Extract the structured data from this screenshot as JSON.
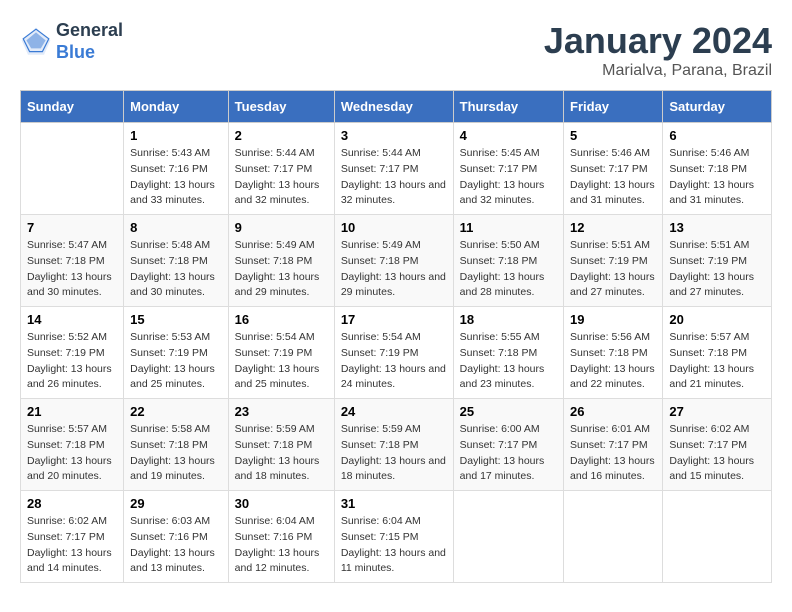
{
  "logo": {
    "line1": "General",
    "line2": "Blue"
  },
  "title": "January 2024",
  "subtitle": "Marialva, Parana, Brazil",
  "days_of_week": [
    "Sunday",
    "Monday",
    "Tuesday",
    "Wednesday",
    "Thursday",
    "Friday",
    "Saturday"
  ],
  "weeks": [
    [
      {
        "day": "",
        "sunrise": "",
        "sunset": "",
        "daylight": ""
      },
      {
        "day": "1",
        "sunrise": "Sunrise: 5:43 AM",
        "sunset": "Sunset: 7:16 PM",
        "daylight": "Daylight: 13 hours and 33 minutes."
      },
      {
        "day": "2",
        "sunrise": "Sunrise: 5:44 AM",
        "sunset": "Sunset: 7:17 PM",
        "daylight": "Daylight: 13 hours and 32 minutes."
      },
      {
        "day": "3",
        "sunrise": "Sunrise: 5:44 AM",
        "sunset": "Sunset: 7:17 PM",
        "daylight": "Daylight: 13 hours and 32 minutes."
      },
      {
        "day": "4",
        "sunrise": "Sunrise: 5:45 AM",
        "sunset": "Sunset: 7:17 PM",
        "daylight": "Daylight: 13 hours and 32 minutes."
      },
      {
        "day": "5",
        "sunrise": "Sunrise: 5:46 AM",
        "sunset": "Sunset: 7:17 PM",
        "daylight": "Daylight: 13 hours and 31 minutes."
      },
      {
        "day": "6",
        "sunrise": "Sunrise: 5:46 AM",
        "sunset": "Sunset: 7:18 PM",
        "daylight": "Daylight: 13 hours and 31 minutes."
      }
    ],
    [
      {
        "day": "7",
        "sunrise": "Sunrise: 5:47 AM",
        "sunset": "Sunset: 7:18 PM",
        "daylight": "Daylight: 13 hours and 30 minutes."
      },
      {
        "day": "8",
        "sunrise": "Sunrise: 5:48 AM",
        "sunset": "Sunset: 7:18 PM",
        "daylight": "Daylight: 13 hours and 30 minutes."
      },
      {
        "day": "9",
        "sunrise": "Sunrise: 5:49 AM",
        "sunset": "Sunset: 7:18 PM",
        "daylight": "Daylight: 13 hours and 29 minutes."
      },
      {
        "day": "10",
        "sunrise": "Sunrise: 5:49 AM",
        "sunset": "Sunset: 7:18 PM",
        "daylight": "Daylight: 13 hours and 29 minutes."
      },
      {
        "day": "11",
        "sunrise": "Sunrise: 5:50 AM",
        "sunset": "Sunset: 7:18 PM",
        "daylight": "Daylight: 13 hours and 28 minutes."
      },
      {
        "day": "12",
        "sunrise": "Sunrise: 5:51 AM",
        "sunset": "Sunset: 7:19 PM",
        "daylight": "Daylight: 13 hours and 27 minutes."
      },
      {
        "day": "13",
        "sunrise": "Sunrise: 5:51 AM",
        "sunset": "Sunset: 7:19 PM",
        "daylight": "Daylight: 13 hours and 27 minutes."
      }
    ],
    [
      {
        "day": "14",
        "sunrise": "Sunrise: 5:52 AM",
        "sunset": "Sunset: 7:19 PM",
        "daylight": "Daylight: 13 hours and 26 minutes."
      },
      {
        "day": "15",
        "sunrise": "Sunrise: 5:53 AM",
        "sunset": "Sunset: 7:19 PM",
        "daylight": "Daylight: 13 hours and 25 minutes."
      },
      {
        "day": "16",
        "sunrise": "Sunrise: 5:54 AM",
        "sunset": "Sunset: 7:19 PM",
        "daylight": "Daylight: 13 hours and 25 minutes."
      },
      {
        "day": "17",
        "sunrise": "Sunrise: 5:54 AM",
        "sunset": "Sunset: 7:19 PM",
        "daylight": "Daylight: 13 hours and 24 minutes."
      },
      {
        "day": "18",
        "sunrise": "Sunrise: 5:55 AM",
        "sunset": "Sunset: 7:18 PM",
        "daylight": "Daylight: 13 hours and 23 minutes."
      },
      {
        "day": "19",
        "sunrise": "Sunrise: 5:56 AM",
        "sunset": "Sunset: 7:18 PM",
        "daylight": "Daylight: 13 hours and 22 minutes."
      },
      {
        "day": "20",
        "sunrise": "Sunrise: 5:57 AM",
        "sunset": "Sunset: 7:18 PM",
        "daylight": "Daylight: 13 hours and 21 minutes."
      }
    ],
    [
      {
        "day": "21",
        "sunrise": "Sunrise: 5:57 AM",
        "sunset": "Sunset: 7:18 PM",
        "daylight": "Daylight: 13 hours and 20 minutes."
      },
      {
        "day": "22",
        "sunrise": "Sunrise: 5:58 AM",
        "sunset": "Sunset: 7:18 PM",
        "daylight": "Daylight: 13 hours and 19 minutes."
      },
      {
        "day": "23",
        "sunrise": "Sunrise: 5:59 AM",
        "sunset": "Sunset: 7:18 PM",
        "daylight": "Daylight: 13 hours and 18 minutes."
      },
      {
        "day": "24",
        "sunrise": "Sunrise: 5:59 AM",
        "sunset": "Sunset: 7:18 PM",
        "daylight": "Daylight: 13 hours and 18 minutes."
      },
      {
        "day": "25",
        "sunrise": "Sunrise: 6:00 AM",
        "sunset": "Sunset: 7:17 PM",
        "daylight": "Daylight: 13 hours and 17 minutes."
      },
      {
        "day": "26",
        "sunrise": "Sunrise: 6:01 AM",
        "sunset": "Sunset: 7:17 PM",
        "daylight": "Daylight: 13 hours and 16 minutes."
      },
      {
        "day": "27",
        "sunrise": "Sunrise: 6:02 AM",
        "sunset": "Sunset: 7:17 PM",
        "daylight": "Daylight: 13 hours and 15 minutes."
      }
    ],
    [
      {
        "day": "28",
        "sunrise": "Sunrise: 6:02 AM",
        "sunset": "Sunset: 7:17 PM",
        "daylight": "Daylight: 13 hours and 14 minutes."
      },
      {
        "day": "29",
        "sunrise": "Sunrise: 6:03 AM",
        "sunset": "Sunset: 7:16 PM",
        "daylight": "Daylight: 13 hours and 13 minutes."
      },
      {
        "day": "30",
        "sunrise": "Sunrise: 6:04 AM",
        "sunset": "Sunset: 7:16 PM",
        "daylight": "Daylight: 13 hours and 12 minutes."
      },
      {
        "day": "31",
        "sunrise": "Sunrise: 6:04 AM",
        "sunset": "Sunset: 7:15 PM",
        "daylight": "Daylight: 13 hours and 11 minutes."
      },
      {
        "day": "",
        "sunrise": "",
        "sunset": "",
        "daylight": ""
      },
      {
        "day": "",
        "sunrise": "",
        "sunset": "",
        "daylight": ""
      },
      {
        "day": "",
        "sunrise": "",
        "sunset": "",
        "daylight": ""
      }
    ]
  ]
}
